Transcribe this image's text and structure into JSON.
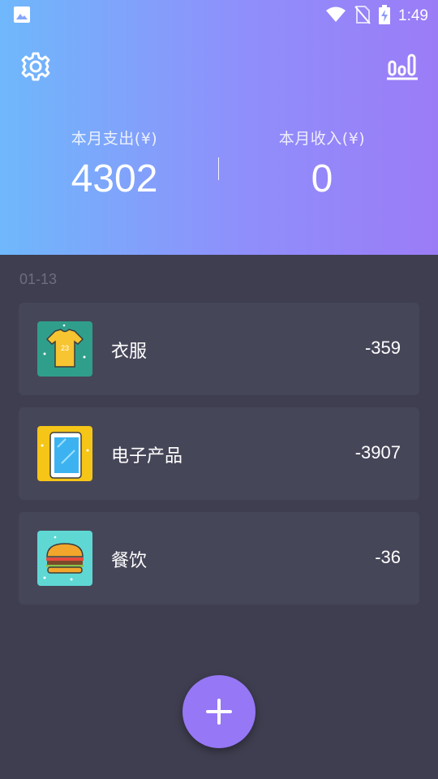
{
  "status_bar": {
    "time": "1:49",
    "icons": [
      "image-icon",
      "wifi-icon",
      "no-sim-icon",
      "battery-charging-icon"
    ]
  },
  "header": {
    "settings_icon": "gear-icon",
    "stats_icon": "bar-chart-icon",
    "expense": {
      "label": "本月支出(¥)",
      "value": "4302"
    },
    "income": {
      "label": "本月收入(¥)",
      "value": "0"
    }
  },
  "records": {
    "date": "01-13",
    "items": [
      {
        "name": "衣服",
        "amount": "-359",
        "icon": "shirt-icon",
        "icon_bg": "#2f9f8c"
      },
      {
        "name": "电子产品",
        "amount": "-3907",
        "icon": "phone-icon",
        "icon_bg": "#f5c518"
      },
      {
        "name": "餐饮",
        "amount": "-36",
        "icon": "burger-icon",
        "icon_bg": "#5fd8d4"
      }
    ]
  },
  "fab": {
    "icon": "plus-icon"
  },
  "colors": {
    "header_gradient_start": "#6fb8fb",
    "header_gradient_end": "#9b7cf7",
    "background": "#3e3e50",
    "card": "#464659",
    "fab": "#9677f6"
  }
}
